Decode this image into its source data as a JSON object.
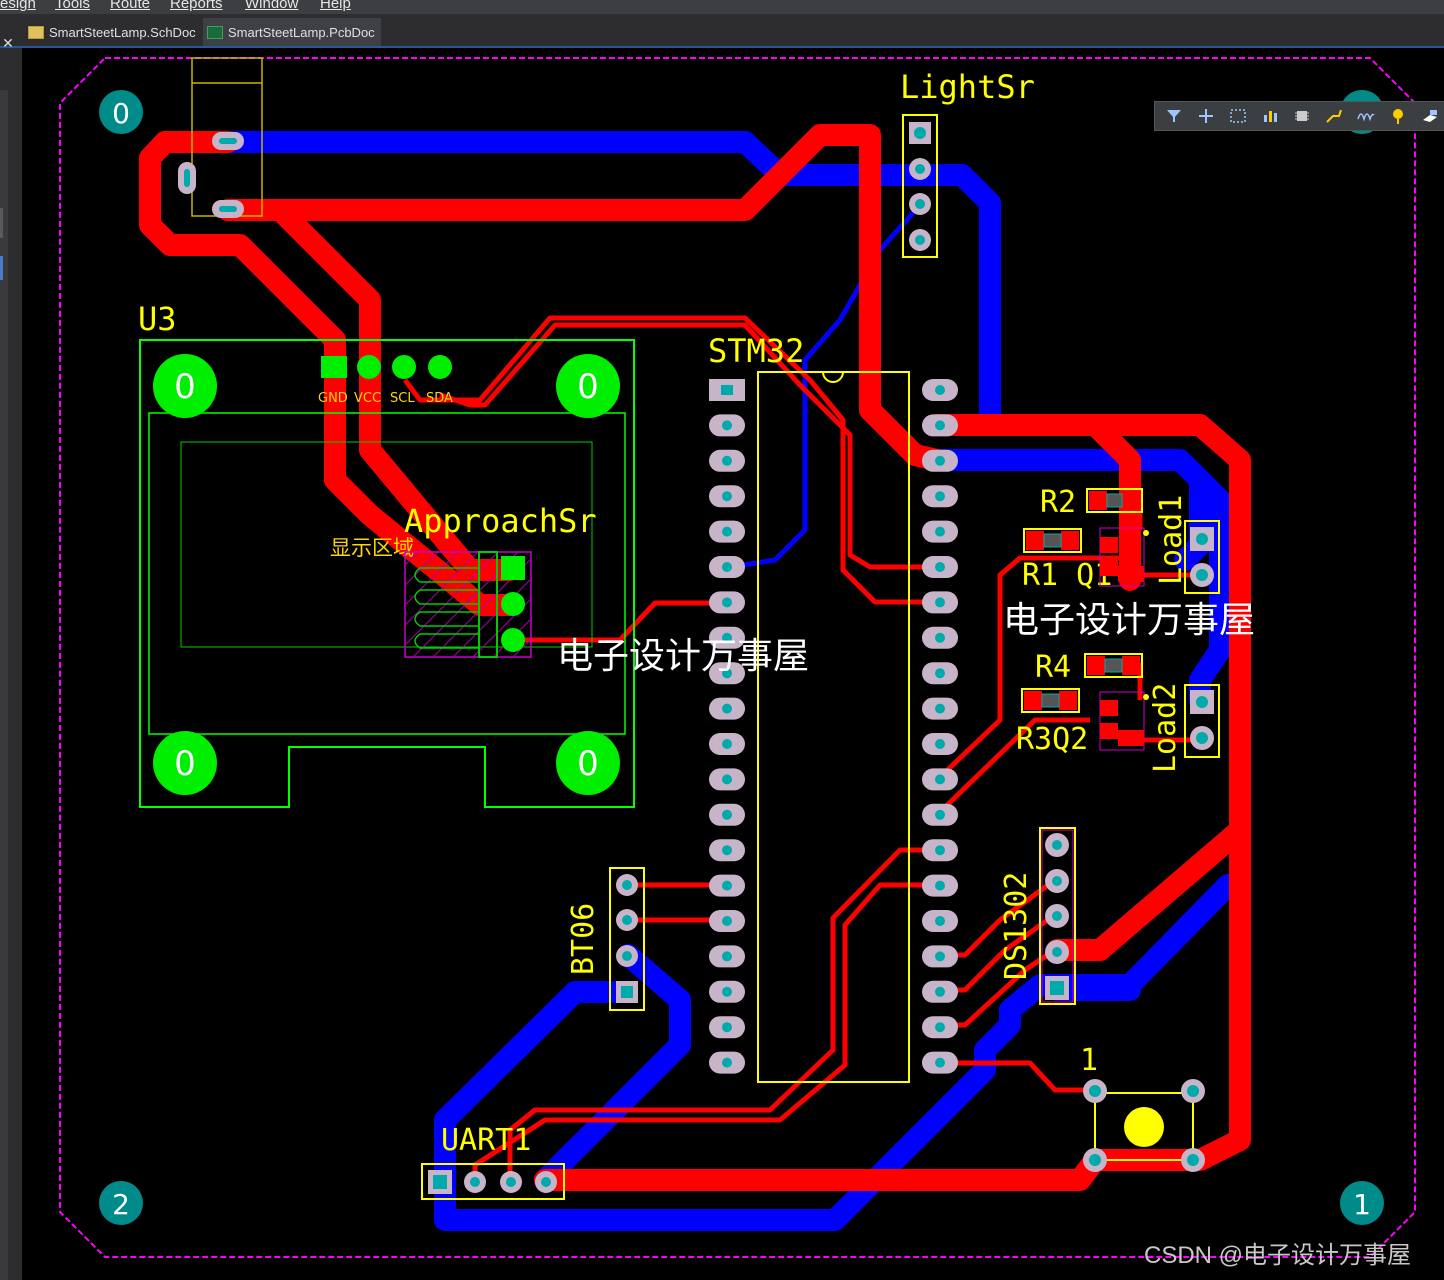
{
  "menubar": {
    "items": [
      "esign",
      "Tools",
      "Route",
      "Reports",
      "Window",
      "Help"
    ]
  },
  "tabs": [
    {
      "label": "SmartSteetLamp.SchDoc",
      "active": false
    },
    {
      "label": "SmartSteetLamp.PcbDoc",
      "active": true
    }
  ],
  "toolbar": {
    "icons": [
      "filter-icon",
      "add-icon",
      "select-rect-icon",
      "chart-icon",
      "component-icon",
      "route-icon",
      "wave-icon",
      "pin-icon",
      "layer-icon",
      "more-icon"
    ]
  },
  "pcb": {
    "colors": {
      "top_layer": "#ff0000",
      "bottom_layer": "#0000ff",
      "silkscreen": "#ffff00",
      "overlay": "#00ff00",
      "board_outline": "#ff00ff",
      "pad": "#00aaaa"
    },
    "mounting_holes": [
      "0",
      "0",
      "2",
      "1"
    ],
    "oled_holes": [
      "0",
      "0",
      "0",
      "0"
    ],
    "designators": {
      "light_sensor": "LightSr",
      "oled": "U3",
      "mcu": "STM32",
      "approach_sensor": "ApproachSr",
      "display_area": "显示区域",
      "r2": "R2",
      "r1_q1": "R1 Q1",
      "load1": "Load1",
      "r4": "R4",
      "r3_q2": "R3Q2",
      "load2": "Load2",
      "rtc": "DS1302",
      "bluetooth": "BT06",
      "uart": "UART1",
      "button": "1"
    },
    "oled_pins": [
      "GND",
      "VCC",
      "SCL",
      "SDA"
    ],
    "watermark": "电子设计万事屋"
  },
  "footer": {
    "credit": "CSDN @电子设计万事屋"
  }
}
